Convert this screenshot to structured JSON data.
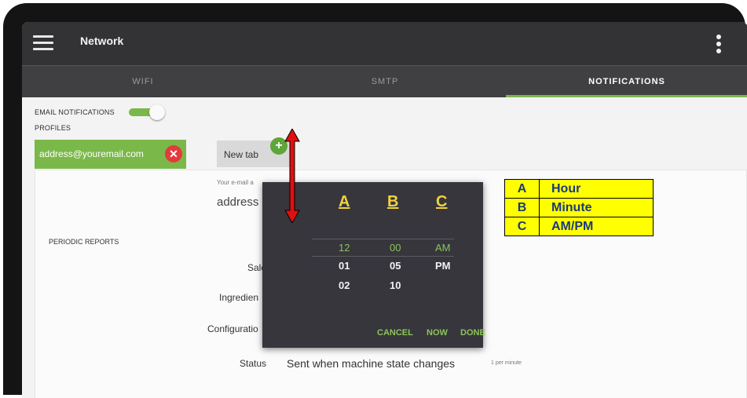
{
  "header": {
    "title": "Network",
    "menu_icon": "hamburger-menu-icon",
    "overflow_icon": "more-vert-icon"
  },
  "tabs": [
    {
      "label": "WIFI",
      "active": false
    },
    {
      "label": "SMTP",
      "active": false
    },
    {
      "label": "NOTIFICATIONS",
      "active": true
    }
  ],
  "notifications": {
    "email_toggle_label": "EMAIL NOTIFICATIONS",
    "email_toggle_on": true,
    "profiles_label": "PROFILES",
    "profile_chip": "address@youremail.com",
    "new_tab_label": "New tab",
    "email_field_label": "Your e-mail a",
    "email_field_value": "address",
    "periodic_reports_label": "PERIODIC REPORTS",
    "rows": {
      "sales": "Sale",
      "ingredients": "Ingredien",
      "configuration": "Configuratio",
      "status": "Status"
    },
    "status_value": "Sent when machine state changes",
    "status_rate": "1 per minute"
  },
  "time_picker": {
    "column_letters": [
      "A",
      "B",
      "C"
    ],
    "hours": [
      "12",
      "01",
      "02"
    ],
    "minutes": [
      "00",
      "05",
      "10"
    ],
    "ampm": [
      "AM",
      "PM"
    ],
    "selected": {
      "hour": "12",
      "minute": "00",
      "ampm": "AM"
    },
    "buttons": {
      "cancel": "CANCEL",
      "now": "NOW",
      "done": "DONE"
    }
  },
  "legend": [
    {
      "key": "A",
      "value": "Hour"
    },
    {
      "key": "B",
      "value": "Minute"
    },
    {
      "key": "C",
      "value": "AM/PM"
    }
  ],
  "colors": {
    "accent_green": "#7bb84a",
    "close_red": "#e33b3b",
    "topbar": "#333335",
    "picker_bg": "#37363d",
    "annotation_yellow": "#ffff00",
    "arrow_red": "#e01010"
  }
}
